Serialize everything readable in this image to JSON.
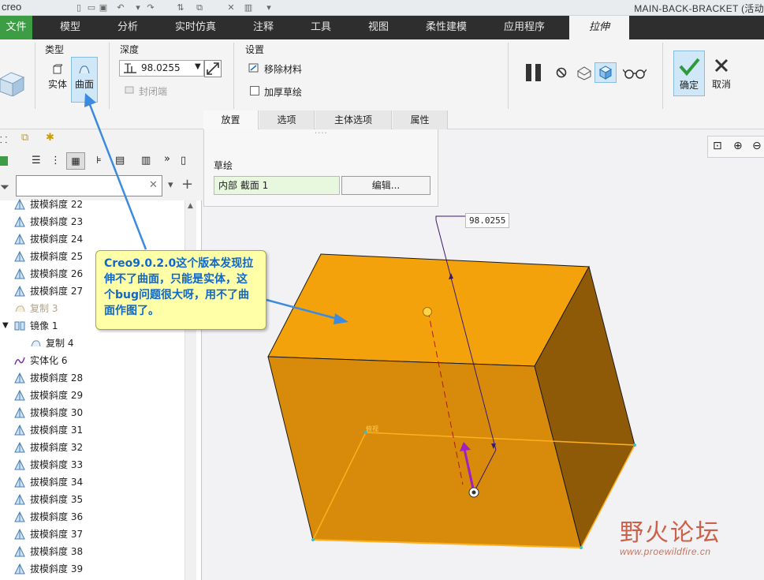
{
  "app": {
    "logo": "creo",
    "title": "MAIN-BACK-BRACKET (活动"
  },
  "menu": {
    "file": "文件",
    "items": [
      "模型",
      "分析",
      "实时仿真",
      "注释",
      "工具",
      "视图",
      "柔性建模",
      "应用程序"
    ],
    "active": "拉伸"
  },
  "ribbon": {
    "type_group": "类型",
    "solid": "实体",
    "surface": "曲面",
    "depth_group": "深度",
    "depth_value": "98.0255",
    "cap_ends": "封闭端",
    "settings_group": "设置",
    "remove_material": "移除材料",
    "thicken_sketch": "加厚草绘",
    "ok": "确定",
    "cancel": "取消"
  },
  "subtabs": [
    "放置",
    "选项",
    "主体选项",
    "属性"
  ],
  "placement_panel": {
    "sketch_label": "草绘",
    "sketch_value": "内部 截面 1",
    "edit_button": "编辑..."
  },
  "tree": {
    "filter_placeholder": "",
    "rows": [
      {
        "label": "拔模斜度 22",
        "kind": "draft"
      },
      {
        "label": "拔模斜度 23",
        "kind": "draft"
      },
      {
        "label": "拔模斜度 24",
        "kind": "draft"
      },
      {
        "label": "拔模斜度 25",
        "kind": "draft"
      },
      {
        "label": "拔模斜度 26",
        "kind": "draft"
      },
      {
        "label": "拔模斜度 27",
        "kind": "draft"
      },
      {
        "label": "复制 3",
        "kind": "copy-dim"
      },
      {
        "label": "镜像 1",
        "kind": "mirror"
      },
      {
        "label": "复制 4",
        "kind": "copy"
      },
      {
        "label": "实体化 6",
        "kind": "solidify"
      },
      {
        "label": "拔模斜度 28",
        "kind": "draft"
      },
      {
        "label": "拔模斜度 29",
        "kind": "draft"
      },
      {
        "label": "拔模斜度 30",
        "kind": "draft"
      },
      {
        "label": "拔模斜度 31",
        "kind": "draft"
      },
      {
        "label": "拔模斜度 32",
        "kind": "draft"
      },
      {
        "label": "拔模斜度 33",
        "kind": "draft"
      },
      {
        "label": "拔模斜度 34",
        "kind": "draft"
      },
      {
        "label": "拔模斜度 35",
        "kind": "draft"
      },
      {
        "label": "拔模斜度 36",
        "kind": "draft"
      },
      {
        "label": "拔模斜度 37",
        "kind": "draft"
      },
      {
        "label": "拔模斜度 38",
        "kind": "draft"
      },
      {
        "label": "拔模斜度 39",
        "kind": "draft"
      }
    ]
  },
  "graphics": {
    "dimension_label": "98.0255",
    "callout_text": "Creo9.0.2.0这个版本发现拉伸不了曲面，只能是实体，这个bug问题很大呀，用不了曲面作图了。"
  },
  "watermark": {
    "name": "野火论坛",
    "url": "www.proewildfire.cn"
  },
  "colors": {
    "menu_bg": "#2e2e2e",
    "file_green": "#3c9d44",
    "model_orange": "#f39c12",
    "callout_bg": "#ffffa8",
    "callout_text": "#1167c8",
    "arrow_blue": "#3c8be0"
  }
}
